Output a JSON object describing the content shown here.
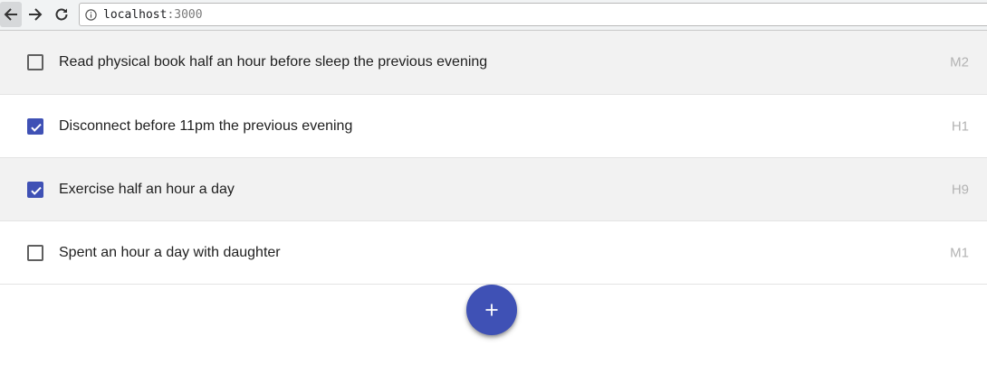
{
  "browser": {
    "url_host": "localhost",
    "url_port": ":3000",
    "back_icon": "arrow-left-icon",
    "forward_icon": "arrow-right-icon",
    "reload_icon": "reload-icon",
    "info_icon": "info-icon"
  },
  "tasks": [
    {
      "label": "Read physical book half an hour before sleep the previous evening",
      "code": "M2",
      "checked": false
    },
    {
      "label": "Disconnect before 11pm the previous evening",
      "code": "H1",
      "checked": true
    },
    {
      "label": "Exercise half an hour a day",
      "code": "H9",
      "checked": true
    },
    {
      "label": "Spent an hour a day with daughter",
      "code": "M1",
      "checked": false
    }
  ],
  "fab": {
    "label": "+",
    "icon": "plus-icon"
  },
  "colors": {
    "accent": "#3f51b5",
    "row_shaded": "#f2f2f2",
    "code_text": "#b3b3b3"
  }
}
